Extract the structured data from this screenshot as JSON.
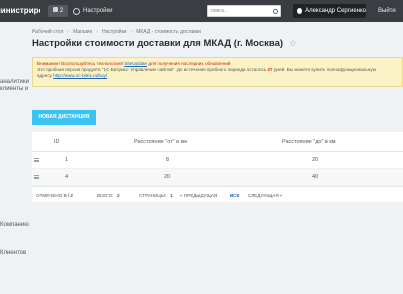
{
  "topbar": {
    "brand": "Администрирование",
    "notifications_count": "2",
    "settings_label": "Настройки",
    "search_placeholder": "поиск...",
    "user_name": "Александр Сергиенко",
    "logout_label": "Выйти"
  },
  "sidebar": {
    "items": [
      "аналитики",
      "клиенты и",
      "Компанию",
      "Клиентов"
    ]
  },
  "breadcrumbs": [
    "Рабочий стол",
    "Магазин",
    "Настройки",
    "МКАД - стоимость доставки"
  ],
  "page": {
    "title": "Настройки стоимости доставки для МКАД (г. Москва)"
  },
  "alert": {
    "line1_prefix": "Внимание! Воспользуйтесь технологией",
    "line1_link": "SiteUpdate",
    "line1_suffix": "для получения последних обновлений",
    "line2_prefix": "Это пробная версия продукта \"1С-Битрикс: Управление сайтом\". До истечения пробного периода осталось",
    "line2_days": "27",
    "line2_suffix": "дней. Вы можете купить полнофункциональную",
    "line3_prefix": "адресу",
    "line3_link": "http://www.1c-bitrix.ru/buy/"
  },
  "toolbar": {
    "new_button": "НОВАЯ ДИСТАНЦИЯ"
  },
  "table": {
    "headers": [
      "ID",
      "Расстояние \"от\" в км",
      "Расстояние \"до\" в км"
    ],
    "rows": [
      {
        "id": "1",
        "from": "8",
        "to": "20"
      },
      {
        "id": "4",
        "from": "20",
        "to": "40"
      }
    ]
  },
  "footer": {
    "selected_label": "ОТМЕЧЕНО:",
    "selected_value": "0 / 2",
    "total_label": "ВСЕГО:",
    "total_value": "2",
    "pages_label": "СТРАНИЦЫ:",
    "pages_value": "1",
    "prev": "« ПРЕДЫДУЩАЯ",
    "all": "ВСЕ",
    "next": "СЛЕДУЮЩАЯ »"
  }
}
